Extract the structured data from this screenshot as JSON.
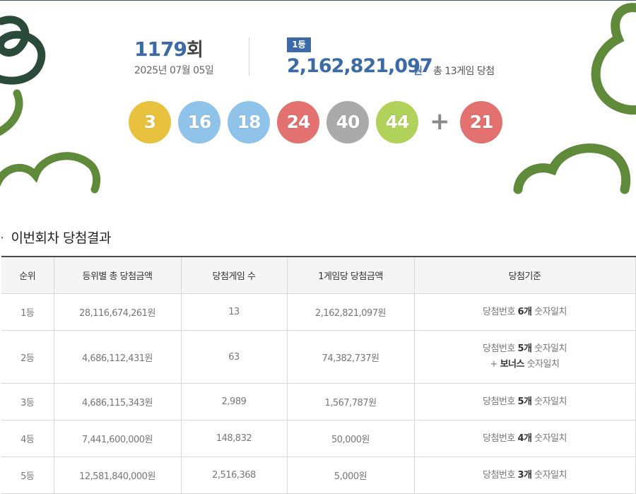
{
  "draw": {
    "round_number": "1179",
    "round_suffix": "회",
    "date": "2025년 07월 05일"
  },
  "first_prize": {
    "badge": "1등",
    "amount": "2,162,821,097",
    "unit": "원",
    "winners_text": "총 13게임 당첨"
  },
  "balls": [
    {
      "number": "3",
      "color": "#e8c23e"
    },
    {
      "number": "16",
      "color": "#8fc3ea"
    },
    {
      "number": "18",
      "color": "#8fc3ea"
    },
    {
      "number": "24",
      "color": "#e3716f"
    },
    {
      "number": "40",
      "color": "#aaaaaa"
    },
    {
      "number": "44",
      "color": "#b1d25a"
    }
  ],
  "plus_sign": "+",
  "bonus_ball": {
    "number": "21",
    "color": "#e3716f"
  },
  "section_title": "이번회차 당첨결과",
  "table": {
    "headers": [
      "순위",
      "등위별 총 당첨금액",
      "당첨게임 수",
      "1게임당 당첨금액",
      "당첨기준"
    ],
    "rows": [
      {
        "rank": "1등",
        "total": "28,116,674,261원",
        "games": "13",
        "per_game": "2,162,821,097원",
        "criteria_prefix": "당첨번호 ",
        "criteria_bold": "6개",
        "criteria_suffix": " 숫자일치"
      },
      {
        "rank": "2등",
        "total": "4,686,112,431원",
        "games": "63",
        "per_game": "74,382,737원",
        "criteria_prefix": "당첨번호 ",
        "criteria_bold": "5개",
        "criteria_suffix": " 숫자일치",
        "criteria_line2_prefix": "+ ",
        "criteria_line2_bold": "보너스",
        "criteria_line2_suffix": " 숫자일치"
      },
      {
        "rank": "3등",
        "total": "4,686,115,343원",
        "games": "2,989",
        "per_game": "1,567,787원",
        "criteria_prefix": "당첨번호 ",
        "criteria_bold": "5개",
        "criteria_suffix": " 숫자일치"
      },
      {
        "rank": "4등",
        "total": "7,441,600,000원",
        "games": "148,832",
        "per_game": "50,000원",
        "criteria_prefix": "당첨번호 ",
        "criteria_bold": "4개",
        "criteria_suffix": " 숫자일치"
      },
      {
        "rank": "5등",
        "total": "12,581,840,000원",
        "games": "2,516,368",
        "per_game": "5,000원",
        "criteria_prefix": "당첨번호 ",
        "criteria_bold": "3개",
        "criteria_suffix": " 숫자일치"
      }
    ]
  },
  "decor_colors": {
    "green": "#5f8a3a",
    "dark": "#2a4a3a"
  }
}
